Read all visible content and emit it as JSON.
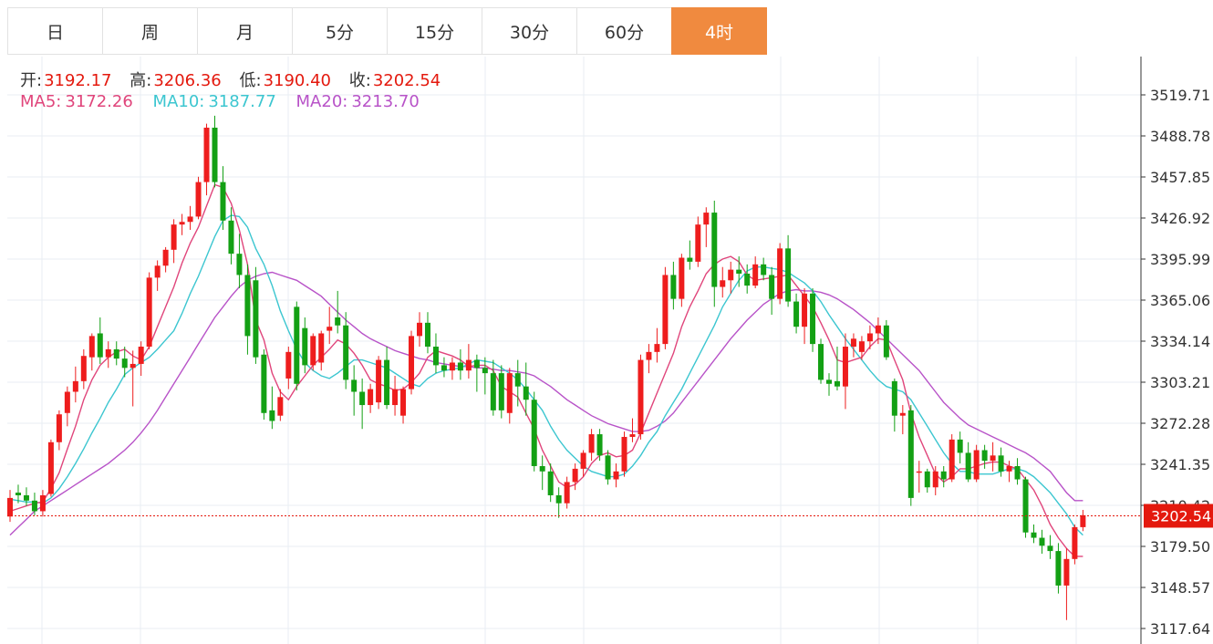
{
  "tabs": [
    {
      "label": "日",
      "active": false
    },
    {
      "label": "周",
      "active": false
    },
    {
      "label": "月",
      "active": false
    },
    {
      "label": "5分",
      "active": false
    },
    {
      "label": "15分",
      "active": false
    },
    {
      "label": "30分",
      "active": false
    },
    {
      "label": "60分",
      "active": false
    },
    {
      "label": "4时",
      "active": true
    }
  ],
  "ohlc": {
    "open_label": "开:",
    "open": "3192.17",
    "high_label": "高:",
    "high": "3206.36",
    "low_label": "低:",
    "low": "3190.40",
    "close_label": "收:",
    "close": "3202.54"
  },
  "ma": {
    "ma5_label": "MA5:",
    "ma5": "3172.26",
    "ma10_label": "MA10:",
    "ma10": "3187.77",
    "ma20_label": "MA20:",
    "ma20": "3213.70"
  },
  "colors": {
    "up": "#ee1d1d",
    "down": "#13a014",
    "ma5": "#e0457b",
    "ma10": "#3cc6d0",
    "ma20": "#b853c8",
    "grid": "#e8eef3",
    "price_line": "#e4190e",
    "active_tab": "#f08a3f"
  },
  "chart_data": {
    "type": "candlestick",
    "y_ticks": [
      "3519.71",
      "3488.78",
      "3457.85",
      "3426.92",
      "3395.99",
      "3365.06",
      "3334.14",
      "3303.21",
      "3272.28",
      "3241.35",
      "3210.42",
      "3179.50",
      "3148.57",
      "3117.64"
    ],
    "ylim": [
      3109,
      3530
    ],
    "current_price": "3202.54",
    "candles": [
      [
        3202,
        3222,
        3198,
        3216
      ],
      [
        3220,
        3226,
        3212,
        3218
      ],
      [
        3218,
        3224,
        3210,
        3214
      ],
      [
        3214,
        3220,
        3203,
        3206
      ],
      [
        3206,
        3222,
        3202,
        3218
      ],
      [
        3219,
        3260,
        3217,
        3258
      ],
      [
        3258,
        3282,
        3252,
        3279
      ],
      [
        3280,
        3300,
        3270,
        3296
      ],
      [
        3296,
        3315,
        3288,
        3304
      ],
      [
        3304,
        3328,
        3298,
        3323
      ],
      [
        3322,
        3340,
        3312,
        3338
      ],
      [
        3340,
        3352,
        3317,
        3322
      ],
      [
        3322,
        3334,
        3314,
        3328
      ],
      [
        3328,
        3334,
        3316,
        3321
      ],
      [
        3321,
        3330,
        3307,
        3314
      ],
      [
        3314,
        3327,
        3285,
        3317
      ],
      [
        3317,
        3334,
        3308,
        3330
      ],
      [
        3330,
        3386,
        3328,
        3382
      ],
      [
        3382,
        3395,
        3372,
        3391
      ],
      [
        3391,
        3405,
        3386,
        3403
      ],
      [
        3403,
        3426,
        3393,
        3422
      ],
      [
        3422,
        3430,
        3414,
        3424
      ],
      [
        3424,
        3436,
        3418,
        3428
      ],
      [
        3428,
        3458,
        3426,
        3454
      ],
      [
        3454,
        3498,
        3444,
        3495
      ],
      [
        3495,
        3504,
        3450,
        3454
      ],
      [
        3454,
        3466,
        3418,
        3425
      ],
      [
        3425,
        3435,
        3392,
        3400
      ],
      [
        3400,
        3415,
        3374,
        3384
      ],
      [
        3384,
        3392,
        3324,
        3338
      ],
      [
        3380,
        3390,
        3317,
        3322
      ],
      [
        3324,
        3328,
        3275,
        3280
      ],
      [
        3282,
        3300,
        3268,
        3274
      ],
      [
        3278,
        3298,
        3274,
        3292
      ],
      [
        3306,
        3330,
        3298,
        3326
      ],
      [
        3360,
        3364,
        3297,
        3302
      ],
      [
        3344,
        3352,
        3310,
        3316
      ],
      [
        3316,
        3340,
        3312,
        3338
      ],
      [
        3318,
        3342,
        3312,
        3340
      ],
      [
        3342,
        3360,
        3332,
        3345
      ],
      [
        3352,
        3372,
        3340,
        3346
      ],
      [
        3346,
        3356,
        3298,
        3305
      ],
      [
        3305,
        3316,
        3278,
        3296
      ],
      [
        3296,
        3306,
        3268,
        3286
      ],
      [
        3286,
        3302,
        3280,
        3298
      ],
      [
        3288,
        3323,
        3283,
        3320
      ],
      [
        3320,
        3330,
        3283,
        3286
      ],
      [
        3286,
        3308,
        3278,
        3298
      ],
      [
        3278,
        3300,
        3272,
        3298
      ],
      [
        3298,
        3342,
        3294,
        3338
      ],
      [
        3338,
        3356,
        3330,
        3348
      ],
      [
        3348,
        3356,
        3325,
        3330
      ],
      [
        3330,
        3340,
        3310,
        3316
      ],
      [
        3316,
        3322,
        3307,
        3312
      ],
      [
        3312,
        3322,
        3305,
        3318
      ],
      [
        3318,
        3328,
        3305,
        3312
      ],
      [
        3312,
        3332,
        3306,
        3320
      ],
      [
        3320,
        3324,
        3296,
        3314
      ],
      [
        3314,
        3322,
        3294,
        3310
      ],
      [
        3310,
        3320,
        3278,
        3282
      ],
      [
        3310,
        3316,
        3276,
        3282
      ],
      [
        3280,
        3314,
        3272,
        3310
      ],
      [
        3310,
        3320,
        3285,
        3300
      ],
      [
        3300,
        3318,
        3278,
        3290
      ],
      [
        3290,
        3296,
        3236,
        3240
      ],
      [
        3240,
        3248,
        3222,
        3236
      ],
      [
        3236,
        3242,
        3213,
        3218
      ],
      [
        3218,
        3224,
        3201,
        3212
      ],
      [
        3212,
        3232,
        3208,
        3228
      ],
      [
        3228,
        3242,
        3222,
        3238
      ],
      [
        3238,
        3252,
        3232,
        3250
      ],
      [
        3250,
        3268,
        3244,
        3264
      ],
      [
        3264,
        3268,
        3244,
        3248
      ],
      [
        3248,
        3252,
        3226,
        3230
      ],
      [
        3230,
        3242,
        3224,
        3236
      ],
      [
        3236,
        3266,
        3232,
        3262
      ],
      [
        3262,
        3276,
        3258,
        3264
      ],
      [
        3264,
        3324,
        3260,
        3320
      ],
      [
        3320,
        3332,
        3310,
        3326
      ],
      [
        3326,
        3344,
        3318,
        3332
      ],
      [
        3332,
        3390,
        3328,
        3384
      ],
      [
        3384,
        3394,
        3358,
        3366
      ],
      [
        3366,
        3400,
        3360,
        3397
      ],
      [
        3397,
        3410,
        3388,
        3394
      ],
      [
        3394,
        3428,
        3390,
        3422
      ],
      [
        3422,
        3435,
        3405,
        3431
      ],
      [
        3431,
        3440,
        3360,
        3375
      ],
      [
        3375,
        3390,
        3367,
        3380
      ],
      [
        3380,
        3394,
        3370,
        3388
      ],
      [
        3388,
        3398,
        3375,
        3385
      ],
      [
        3385,
        3392,
        3370,
        3376
      ],
      [
        3376,
        3398,
        3374,
        3392
      ],
      [
        3392,
        3397,
        3380,
        3384
      ],
      [
        3384,
        3390,
        3354,
        3366
      ],
      [
        3366,
        3408,
        3362,
        3404
      ],
      [
        3404,
        3414,
        3360,
        3364
      ],
      [
        3364,
        3370,
        3340,
        3345
      ],
      [
        3345,
        3374,
        3332,
        3370
      ],
      [
        3370,
        3374,
        3326,
        3332
      ],
      [
        3332,
        3336,
        3302,
        3305
      ],
      [
        3305,
        3310,
        3293,
        3302
      ],
      [
        3304,
        3330,
        3297,
        3300
      ],
      [
        3300,
        3340,
        3283,
        3330
      ],
      [
        3330,
        3340,
        3322,
        3336
      ],
      [
        3326,
        3338,
        3320,
        3334
      ],
      [
        3334,
        3346,
        3328,
        3340
      ],
      [
        3340,
        3352,
        3332,
        3346
      ],
      [
        3346,
        3350,
        3320,
        3322
      ],
      [
        3304,
        3306,
        3266,
        3278
      ],
      [
        3278,
        3286,
        3264,
        3280
      ],
      [
        3282,
        3286,
        3210,
        3216
      ],
      [
        3235,
        3244,
        3220,
        3236
      ],
      [
        3236,
        3238,
        3220,
        3224
      ],
      [
        3224,
        3240,
        3218,
        3236
      ],
      [
        3236,
        3240,
        3224,
        3230
      ],
      [
        3230,
        3264,
        3228,
        3260
      ],
      [
        3260,
        3266,
        3242,
        3250
      ],
      [
        3250,
        3258,
        3228,
        3230
      ],
      [
        3230,
        3256,
        3228,
        3252
      ],
      [
        3252,
        3256,
        3238,
        3244
      ],
      [
        3244,
        3258,
        3236,
        3248
      ],
      [
        3248,
        3254,
        3232,
        3236
      ],
      [
        3236,
        3244,
        3228,
        3240
      ],
      [
        3240,
        3246,
        3226,
        3230
      ],
      [
        3230,
        3232,
        3186,
        3190
      ],
      [
        3190,
        3196,
        3182,
        3186
      ],
      [
        3186,
        3192,
        3174,
        3180
      ],
      [
        3180,
        3188,
        3170,
        3176
      ],
      [
        3176,
        3182,
        3144,
        3150
      ],
      [
        3150,
        3178,
        3124,
        3170
      ],
      [
        3170,
        3196,
        3166,
        3194
      ],
      [
        3194,
        3207,
        3191,
        3203
      ]
    ],
    "ma5": [
      3206,
      3208,
      3210,
      3212,
      3213,
      3223,
      3235,
      3253,
      3270,
      3290,
      3305,
      3316,
      3322,
      3326,
      3328,
      3323,
      3320,
      3330,
      3345,
      3360,
      3375,
      3393,
      3408,
      3420,
      3436,
      3452,
      3450,
      3438,
      3418,
      3392,
      3350,
      3335,
      3310,
      3296,
      3290,
      3300,
      3308,
      3316,
      3322,
      3328,
      3335,
      3332,
      3325,
      3316,
      3305,
      3302,
      3300,
      3297,
      3298,
      3303,
      3310,
      3322,
      3327,
      3325,
      3323,
      3320,
      3315,
      3316,
      3316,
      3312,
      3300,
      3296,
      3292,
      3280,
      3268,
      3252,
      3240,
      3228,
      3224,
      3226,
      3232,
      3242,
      3248,
      3250,
      3247,
      3248,
      3252,
      3265,
      3280,
      3295,
      3310,
      3325,
      3345,
      3360,
      3372,
      3385,
      3392,
      3396,
      3398,
      3394,
      3384,
      3380,
      3381,
      3382,
      3383,
      3384,
      3376,
      3368,
      3360,
      3348,
      3335,
      3320,
      3318,
      3320,
      3322,
      3330,
      3336,
      3335,
      3320,
      3305,
      3280,
      3262,
      3248,
      3234,
      3228,
      3232,
      3238,
      3238,
      3240,
      3242,
      3243,
      3243,
      3240,
      3238,
      3230,
      3222,
      3210,
      3196,
      3186,
      3178,
      3172,
      3172
    ],
    "ma10": [
      3215,
      3214,
      3213,
      3213,
      3212,
      3216,
      3223,
      3232,
      3242,
      3253,
      3265,
      3276,
      3288,
      3298,
      3309,
      3314,
      3318,
      3322,
      3328,
      3335,
      3342,
      3355,
      3370,
      3383,
      3398,
      3413,
      3425,
      3429,
      3428,
      3420,
      3404,
      3392,
      3376,
      3357,
      3342,
      3328,
      3318,
      3312,
      3308,
      3306,
      3310,
      3315,
      3320,
      3320,
      3318,
      3316,
      3314,
      3310,
      3306,
      3302,
      3300,
      3306,
      3310,
      3312,
      3313,
      3314,
      3317,
      3320,
      3319,
      3318,
      3314,
      3310,
      3305,
      3298,
      3290,
      3282,
      3270,
      3260,
      3252,
      3246,
      3240,
      3236,
      3234,
      3232,
      3232,
      3234,
      3240,
      3248,
      3258,
      3266,
      3278,
      3288,
      3298,
      3310,
      3322,
      3334,
      3346,
      3360,
      3370,
      3380,
      3387,
      3390,
      3390,
      3389,
      3388,
      3386,
      3382,
      3378,
      3372,
      3364,
      3354,
      3345,
      3336,
      3328,
      3320,
      3312,
      3305,
      3300,
      3298,
      3296,
      3290,
      3280,
      3270,
      3260,
      3250,
      3242,
      3236,
      3236,
      3234,
      3234,
      3234,
      3236,
      3238,
      3238,
      3236,
      3232,
      3226,
      3220,
      3212,
      3204,
      3194,
      3188
    ],
    "ma20": [
      3188,
      3194,
      3200,
      3206,
      3210,
      3214,
      3218,
      3222,
      3226,
      3230,
      3234,
      3238,
      3242,
      3247,
      3252,
      3258,
      3265,
      3273,
      3282,
      3292,
      3302,
      3312,
      3322,
      3332,
      3342,
      3352,
      3360,
      3368,
      3375,
      3380,
      3383,
      3385,
      3386,
      3384,
      3382,
      3380,
      3376,
      3372,
      3368,
      3362,
      3356,
      3350,
      3345,
      3340,
      3336,
      3333,
      3330,
      3327,
      3325,
      3323,
      3321,
      3320,
      3318,
      3317,
      3316,
      3315,
      3315,
      3314,
      3314,
      3313,
      3312,
      3312,
      3311,
      3310,
      3308,
      3304,
      3300,
      3295,
      3290,
      3286,
      3282,
      3278,
      3275,
      3272,
      3270,
      3268,
      3266,
      3266,
      3267,
      3270,
      3274,
      3280,
      3288,
      3296,
      3304,
      3312,
      3320,
      3328,
      3336,
      3343,
      3350,
      3356,
      3362,
      3366,
      3370,
      3372,
      3373,
      3372,
      3372,
      3371,
      3369,
      3366,
      3362,
      3358,
      3353,
      3348,
      3342,
      3336,
      3330,
      3324,
      3318,
      3312,
      3304,
      3296,
      3288,
      3282,
      3276,
      3271,
      3268,
      3265,
      3262,
      3259,
      3256,
      3253,
      3250,
      3246,
      3241,
      3236,
      3228,
      3220,
      3214,
      3214
    ]
  }
}
